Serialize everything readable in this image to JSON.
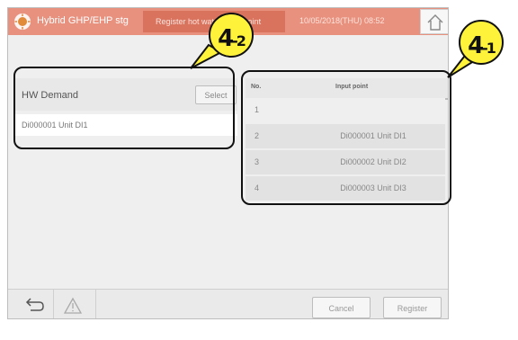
{
  "header": {
    "title": "Hybrid GHP/EHP stg",
    "tab_label": "Register hot water input point",
    "datetime": "10/05/2018(THU) 08:52",
    "home_icon": "home-icon",
    "sun_icon": "sun-icon"
  },
  "left_panel": {
    "title": "HW Demand",
    "select_label": "Select",
    "value": "Di000001 Unit DI1"
  },
  "right_panel": {
    "col_no": "No.",
    "col_input": "Input point",
    "rows": [
      {
        "no": "1",
        "value": ""
      },
      {
        "no": "2",
        "value": "Di000001 Unit DI1"
      },
      {
        "no": "3",
        "value": "Di000002 Unit DI2"
      },
      {
        "no": "4",
        "value": "Di000003 Unit DI3"
      }
    ]
  },
  "footer": {
    "back_icon": "back-arrow-icon",
    "warning_icon": "warning-icon",
    "cancel_label": "Cancel",
    "register_label": "Register"
  },
  "callouts": {
    "c1_main": "4",
    "c1_sub": "-1",
    "c2_main": "4",
    "c2_sub": "-2"
  },
  "colors": {
    "header": "#e8917e",
    "badge": "#fff23a"
  }
}
